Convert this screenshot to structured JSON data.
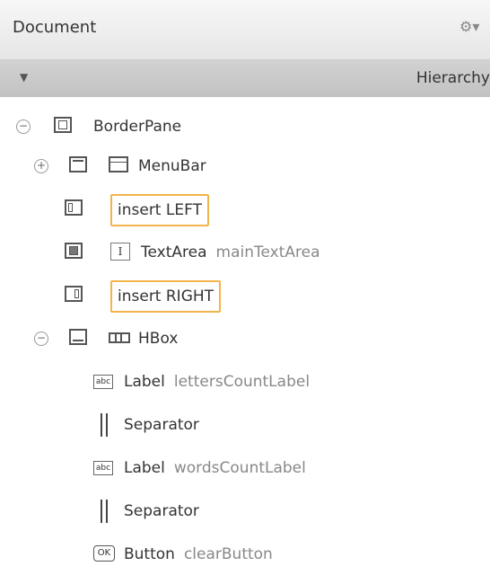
{
  "header": {
    "title": "Document",
    "gear_glyph": "⚙▾"
  },
  "subheader": {
    "arrow_glyph": "▼",
    "label": "Hierarchy"
  },
  "tree": [
    {
      "name": "BorderPane",
      "sub": ""
    },
    {
      "name": "MenuBar",
      "sub": ""
    },
    {
      "insert": "insert LEFT"
    },
    {
      "name": "TextArea",
      "sub": "mainTextArea"
    },
    {
      "insert": "insert RIGHT"
    },
    {
      "name": "HBox",
      "sub": ""
    },
    {
      "name": "Label",
      "sub": "lettersCountLabel"
    },
    {
      "name": "Separator",
      "sub": ""
    },
    {
      "name": "Label",
      "sub": "wordsCountLabel"
    },
    {
      "name": "Separator",
      "sub": ""
    },
    {
      "name": "Button",
      "sub": "clearButton"
    }
  ],
  "icons": {
    "collapse": "−",
    "expand": "+",
    "textarea_glyph": "I",
    "label_glyph": "abc",
    "button_glyph": "OK"
  }
}
